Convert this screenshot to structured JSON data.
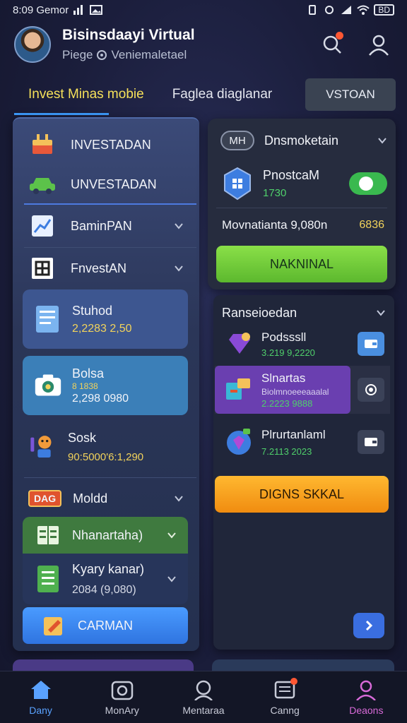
{
  "status_bar": {
    "time": "8:09 Gemor",
    "battery": "BD"
  },
  "header": {
    "title": "Bisinsdaayi Virtual",
    "subtitle_prefix": "Piege",
    "subtitle": "Veniemaletael"
  },
  "tabs": [
    {
      "label": "Invest Minas mobie",
      "active": true
    },
    {
      "label": "Faglea diaglanar",
      "active": false
    }
  ],
  "tab_button": "VSTOAN",
  "left_panel": {
    "rows": [
      {
        "label": "INVESTADAN",
        "icon": "cake-icon"
      },
      {
        "label": "UNVESTADAN",
        "icon": "car-icon"
      },
      {
        "label": "BaminPAN",
        "icon": "chart-icon"
      },
      {
        "label": "FnvestAN",
        "icon": "grid-icon"
      }
    ],
    "cards": [
      {
        "title": "Stuhod",
        "value": "2,2283 2,50"
      },
      {
        "title": "Bolsa",
        "subvalue": "8 1838",
        "value": "2,298 0980"
      }
    ],
    "sosk": {
      "title": "Sosk",
      "value": "90:5000'6:1,290"
    },
    "moldd": {
      "badge": "DAG",
      "label": "Moldd"
    },
    "nhanartaha": {
      "label": "Nhanartaha)"
    },
    "kyary": {
      "title": "Kyary kanar)",
      "value": "2084 (9,080)"
    },
    "carman_button": "CARMAN"
  },
  "right_panel": {
    "badge": "MH",
    "title": "Dnsmoketain",
    "pnostcam": {
      "title": "PnostcaM",
      "value": "1730"
    },
    "movnatianta": {
      "label": "Movnatianta 9,080n",
      "value": "6836"
    },
    "action_button": "NAKNINAL"
  },
  "right_panel2": {
    "title": "Ranseioedan",
    "items": [
      {
        "title": "Podsssll",
        "value": "3.219 9,2220"
      },
      {
        "title": "Slnartas",
        "sub": "Biolmnoeeeaaalal",
        "value": "2.2223 9888"
      },
      {
        "title": "Plrurtanlaml",
        "value": "7.2113 2023"
      }
    ],
    "orange_button": "DIGNS SKKAL"
  },
  "bottom_nav": [
    {
      "label": "Dany",
      "icon": "home-icon",
      "state": "active"
    },
    {
      "label": "MonAry",
      "icon": "camera-icon",
      "state": ""
    },
    {
      "label": "Mentaraa",
      "icon": "search-icon",
      "state": ""
    },
    {
      "label": "Canng",
      "icon": "message-icon",
      "state": ""
    },
    {
      "label": "Deaons",
      "icon": "user-icon",
      "state": "purple"
    }
  ],
  "colors": {
    "accent_blue": "#3d9cff",
    "yellow": "#f2d35b",
    "green": "#4fcf6b",
    "lime_button": "#7ed63c",
    "orange_button": "#f5a623",
    "carman_button": "#3f8cff",
    "purple_item": "#6a3fb0"
  }
}
